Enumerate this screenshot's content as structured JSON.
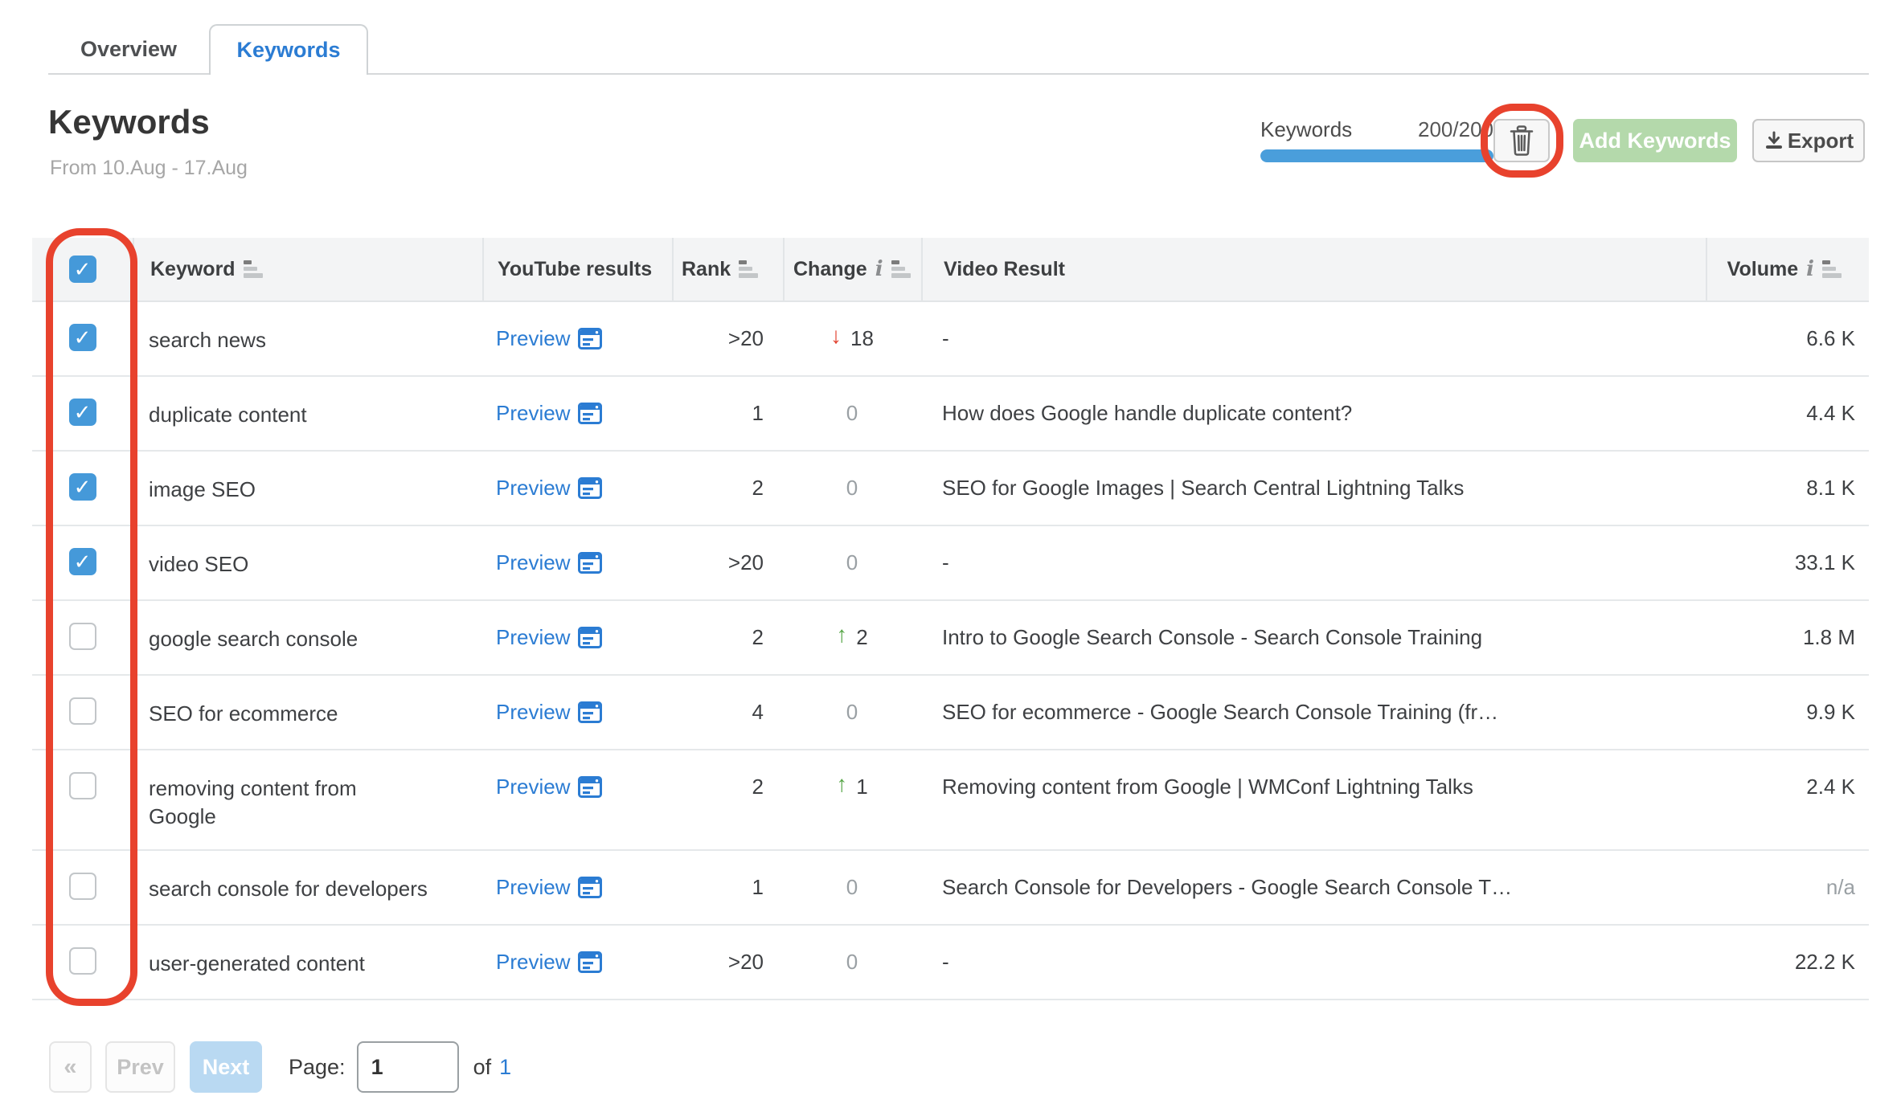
{
  "tabs": {
    "items": [
      {
        "label": "Overview",
        "active": false
      },
      {
        "label": "Keywords",
        "active": true
      }
    ]
  },
  "page_header": {
    "title": "Keywords",
    "subtitle": "From 10.Aug - 17.Aug"
  },
  "toolbar": {
    "counter_label": "Keywords",
    "counter_value": "200/200",
    "progress_percent": 100,
    "add_keywords_label": "Add Keywords",
    "export_label": "Export"
  },
  "table": {
    "preview_label": "Preview",
    "columns": {
      "keyword": "Keyword",
      "youtube_results": "YouTube results",
      "rank": "Rank",
      "change": "Change",
      "video_result": "Video Result",
      "volume": "Volume"
    },
    "rows": [
      {
        "checked": true,
        "keyword": "search news",
        "rank": ">20",
        "change": {
          "dir": "down",
          "value": "18"
        },
        "video": "-",
        "volume": "6.6 K"
      },
      {
        "checked": true,
        "keyword": "duplicate content",
        "rank": "1",
        "change": {
          "dir": "none",
          "value": "0"
        },
        "video": "How does Google handle duplicate content?",
        "volume": "4.4 K"
      },
      {
        "checked": true,
        "keyword": "image SEO",
        "rank": "2",
        "change": {
          "dir": "none",
          "value": "0"
        },
        "video": "SEO for Google Images | Search Central Lightning Talks",
        "volume": "8.1 K"
      },
      {
        "checked": true,
        "keyword": "video SEO",
        "rank": ">20",
        "change": {
          "dir": "none",
          "value": "0"
        },
        "video": "-",
        "volume": "33.1 K"
      },
      {
        "checked": false,
        "keyword": "google search console",
        "rank": "2",
        "change": {
          "dir": "up",
          "value": "2"
        },
        "video": "Intro to Google Search Console - Search Console Training",
        "volume": "1.8 M"
      },
      {
        "checked": false,
        "keyword": "SEO for ecommerce",
        "rank": "4",
        "change": {
          "dir": "none",
          "value": "0"
        },
        "video": "SEO for ecommerce - Google Search Console Training (fr…",
        "volume": "9.9 K"
      },
      {
        "checked": false,
        "keyword": "removing content from Google",
        "keyword_wraps": true,
        "rank": "2",
        "change": {
          "dir": "up",
          "value": "1"
        },
        "video": "Removing content from Google | WMConf Lightning Talks",
        "volume": "2.4 K"
      },
      {
        "checked": false,
        "keyword": "search console for developers",
        "rank": "1",
        "change": {
          "dir": "none",
          "value": "0"
        },
        "video": "Search Console for Developers - Google Search Console T…",
        "volume": "n/a"
      },
      {
        "checked": false,
        "keyword": "user-generated content",
        "rank": ">20",
        "change": {
          "dir": "none",
          "value": "0"
        },
        "video": "-",
        "volume": "22.2 K"
      }
    ]
  },
  "pagination": {
    "first_label": "«",
    "prev_label": "Prev",
    "next_label": "Next",
    "page_label": "Page:",
    "page_value": "1",
    "of_label": "of",
    "total_pages": "1"
  },
  "icons": {
    "check": "✓",
    "down_arrow": "↓",
    "up_arrow": "↑"
  },
  "annotations": {
    "color": "#e8422d",
    "highlights": [
      "keyword-checkbox-column",
      "delete-keywords-button"
    ]
  },
  "colors": {
    "accent_blue": "#2b7cd3",
    "checkbox_blue": "#4599d9",
    "progress_blue": "#4a9edb",
    "green_up": "#55a546",
    "red_down": "#e2402e",
    "annotation_red": "#e8422d",
    "add_button_green": "#b4d9ab"
  }
}
